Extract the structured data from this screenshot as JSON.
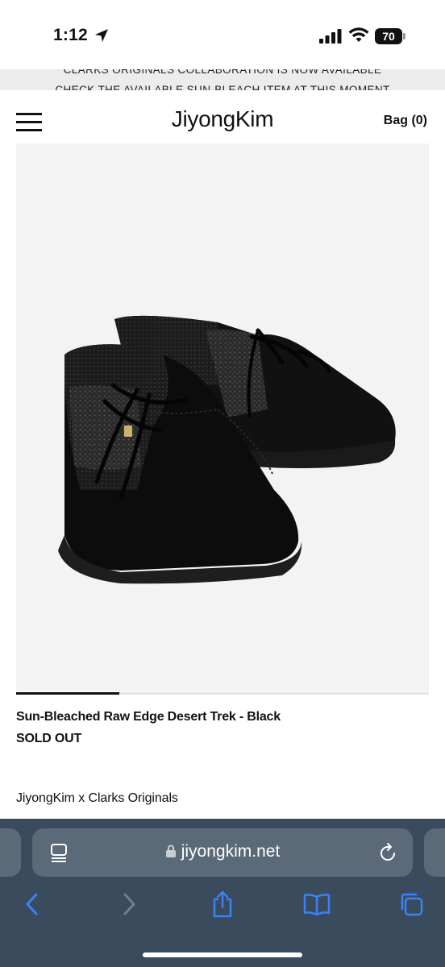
{
  "status_bar": {
    "time": "1:12",
    "battery": "70",
    "icons": [
      "location-arrow-icon",
      "cellular-signal-icon",
      "wifi-icon",
      "battery-icon"
    ]
  },
  "announcement": {
    "line1": "CLARKS ORIGINALS COLLABORATION IS NOW AVAILABLE",
    "line2": "CHECK THE AVAILABLE SUN-BLEACH ITEM AT THIS MOMENT"
  },
  "header": {
    "logo": "JiyongKim",
    "bag_label": "Bag (0)"
  },
  "product": {
    "title": "Sun-Bleached Raw Edge Desert Trek - Black",
    "stock_status": "SOLD OUT",
    "collaboration": "JiyongKim x Clarks Originals",
    "image_progress": 0.25
  },
  "browser": {
    "url": "jiyongkim.net",
    "toolbar_icons": [
      "back-icon",
      "forward-icon",
      "share-icon",
      "bookmarks-icon",
      "tabs-icon"
    ]
  },
  "colors": {
    "browser_bg": "#3a4b5d",
    "url_bar_bg": "#5b6a79",
    "toolbar_active": "#3b82f6",
    "toolbar_disabled": "#6f7f90",
    "image_bg": "#f3f3f3"
  }
}
